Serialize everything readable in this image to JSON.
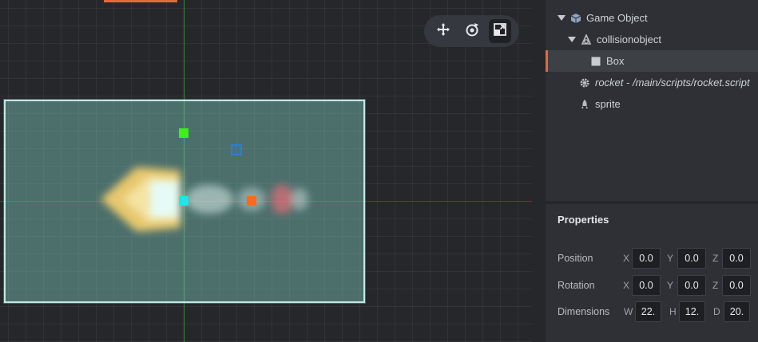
{
  "toolbar": {
    "tools": [
      {
        "icon": "move-icon",
        "active": false
      },
      {
        "icon": "rotate-icon",
        "active": false
      },
      {
        "icon": "scale-icon",
        "active": true
      }
    ]
  },
  "outline": {
    "items": [
      {
        "label": "Game Object",
        "icon": "cube-icon",
        "expanded": true,
        "level": 0
      },
      {
        "label": "collisionobject",
        "icon": "collision-icon",
        "expanded": true,
        "level": 1
      },
      {
        "label": "Box",
        "icon": "box-icon",
        "selected": true,
        "level": 2
      },
      {
        "label": "rocket - /main/scripts/rocket.script",
        "icon": "gear-icon",
        "level": 1
      },
      {
        "label": "sprite",
        "icon": "sprite-icon",
        "level": 1
      }
    ]
  },
  "properties": {
    "title": "Properties",
    "position": {
      "label": "Position",
      "x_label": "X",
      "y_label": "Y",
      "z_label": "Z",
      "x": "0.0",
      "y": "0.0",
      "z": "0.0"
    },
    "rotation": {
      "label": "Rotation",
      "x_label": "X",
      "y_label": "Y",
      "z_label": "Z",
      "x": "0.0",
      "y": "0.0",
      "z": "0.0"
    },
    "dimensions": {
      "label": "Dimensions",
      "w_label": "W",
      "h_label": "H",
      "d_label": "D",
      "w": "22.",
      "h": "12.",
      "d": "20."
    }
  },
  "colors": {
    "accent": "#e2693d",
    "collision_fill": "#78beb4",
    "x_axis": "#8a2a2d",
    "y_axis": "#3c8a3c",
    "handle_green": "#3df018",
    "handle_cyan": "#1ee6e6",
    "handle_orange": "#ff6a1a",
    "handle_blue": "#2a7fd4"
  }
}
